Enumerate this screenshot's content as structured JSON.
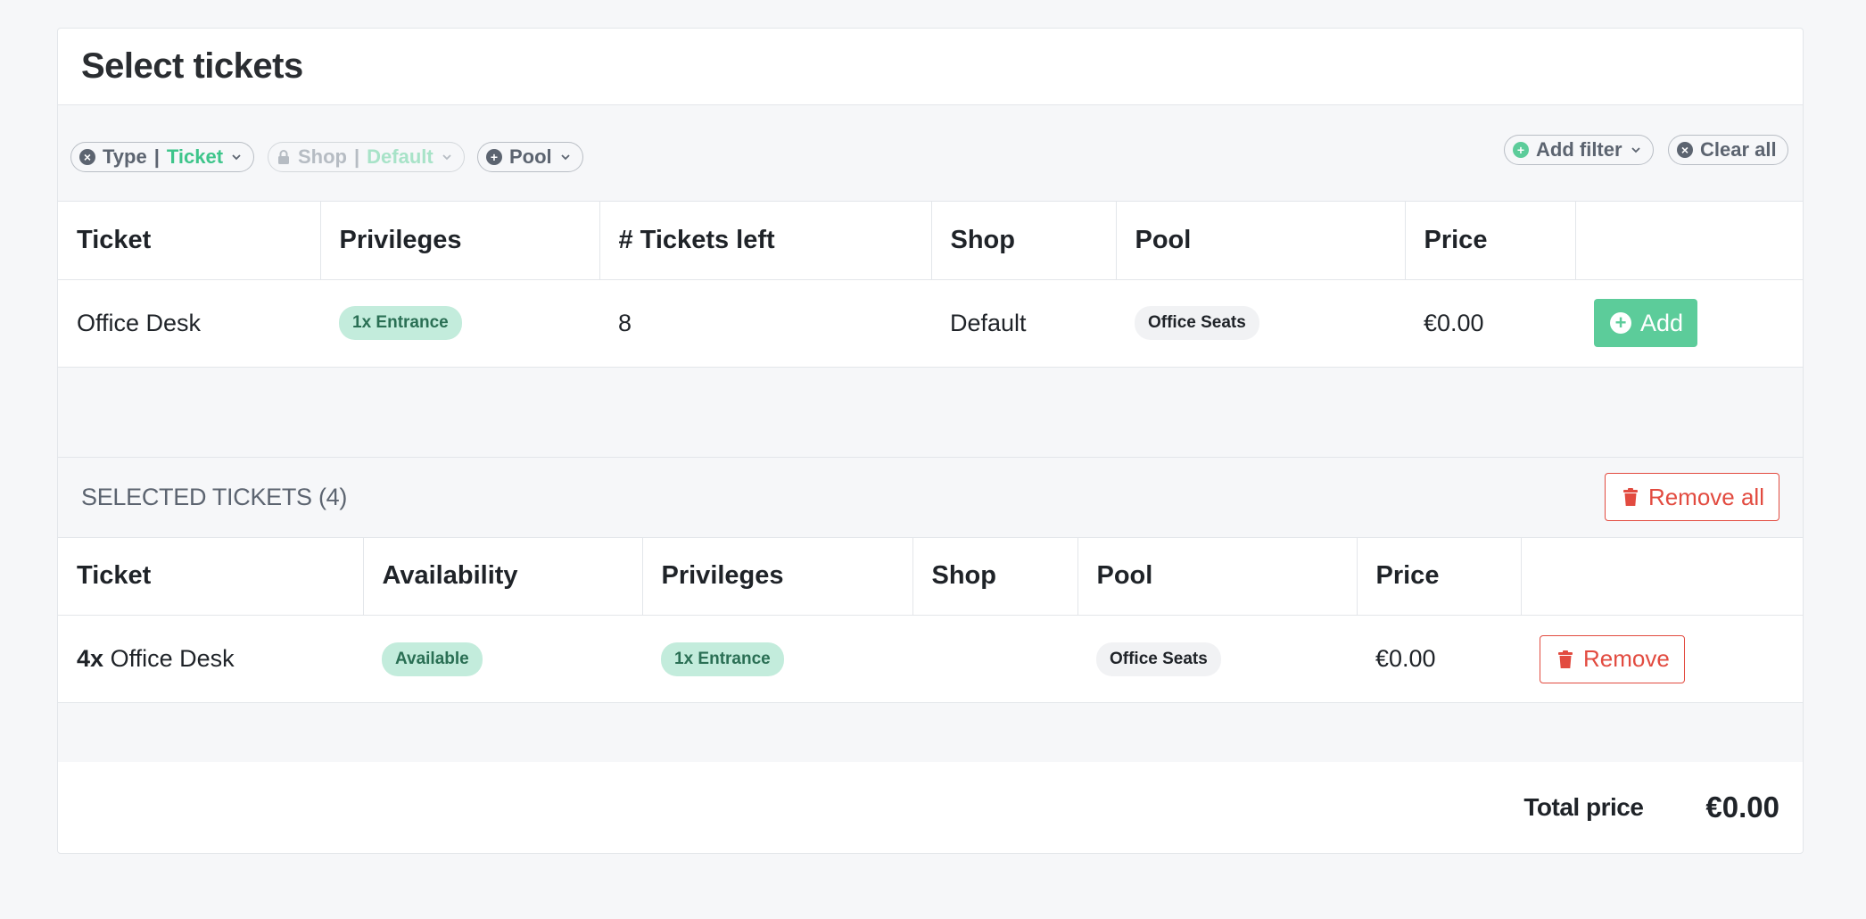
{
  "page_title": "Select tickets",
  "filters": {
    "type": {
      "label": "Type",
      "sep": "|",
      "value": "Ticket"
    },
    "shop": {
      "label": "Shop",
      "sep": "|",
      "value": "Default"
    },
    "pool": {
      "label": "Pool"
    },
    "add_filter": "Add filter",
    "clear_all": "Clear all"
  },
  "available_table": {
    "headers": [
      "Ticket",
      "Privileges",
      "# Tickets left",
      "Shop",
      "Pool",
      "Price",
      ""
    ],
    "rows": [
      {
        "ticket": "Office Desk",
        "privileges": "1x Entrance",
        "tickets_left": "8",
        "shop": "Default",
        "pool": "Office Seats",
        "price": "€0.00",
        "action": "Add"
      }
    ]
  },
  "selected": {
    "title": "SELECTED TICKETS (4)",
    "remove_all": "Remove all",
    "headers": [
      "Ticket",
      "Availability",
      "Privileges",
      "Shop",
      "Pool",
      "Price",
      ""
    ],
    "rows": [
      {
        "qty": "4x",
        "ticket": "Office Desk",
        "availability": "Available",
        "privileges": "1x Entrance",
        "shop": "",
        "pool": "Office Seats",
        "price": "€0.00",
        "action": "Remove"
      }
    ]
  },
  "total": {
    "label": "Total price",
    "value": "€0.00"
  },
  "colors": {
    "accent_green": "#5ccc9a",
    "danger_red": "#e24b40",
    "badge_green_bg": "#c3ecdc"
  },
  "icons": {
    "type_filter": "close-circle-icon",
    "shop_filter": "lock-icon",
    "pool_filter": "plus-circle-icon",
    "add_filter": "plus-circle-icon",
    "clear_all": "close-circle-icon",
    "add_button": "plus-circle-icon",
    "remove_button": "trash-icon"
  }
}
